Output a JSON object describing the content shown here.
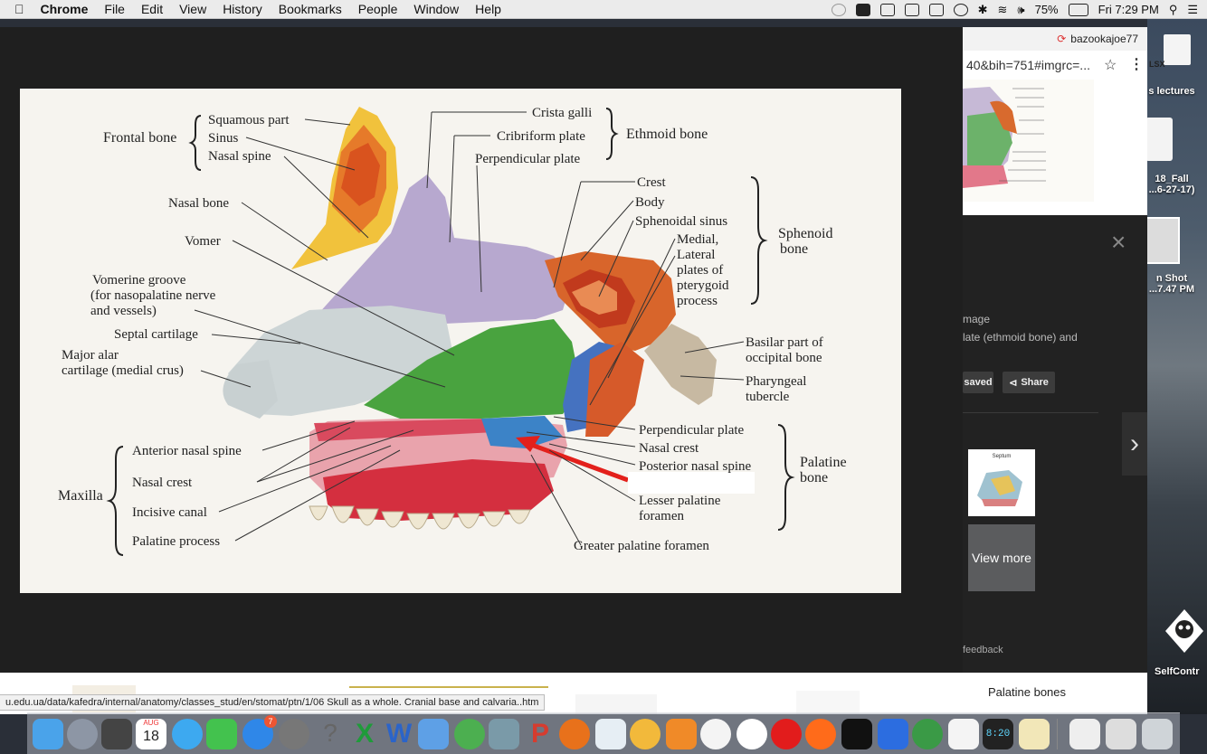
{
  "menubar": {
    "app": "Chrome",
    "menus": [
      "File",
      "Edit",
      "View",
      "History",
      "Bookmarks",
      "People",
      "Window",
      "Help"
    ],
    "battery": "75%",
    "clock": "Fri 7:29 PM"
  },
  "browser": {
    "user": "bazookajoe77",
    "address": "40&bih=751#imgrc=...",
    "status_url": "u.edu.ua/data/kafedra/internal/anatomy/classes_stud/en/stomat/ptn/1/06 Skull as a whole. Cranial base and calvaria..htm"
  },
  "image_panel": {
    "label_image": "mage",
    "caption": "late (ethmoid bone) and",
    "saved_label": "saved",
    "share_label": "Share",
    "feedback": "feedback",
    "related_title": "Septum",
    "view_more": "View more",
    "bottom_title": "Palatine bones"
  },
  "desktop": {
    "lectures": "s lectures",
    "file1_a": "18_Fall",
    "file1_b": "...6-27-17)",
    "shot_a": "n Shot",
    "shot_b": "...7.47 PM",
    "selfcontrol": "SelfContr",
    "xlsx": "LSX"
  },
  "figure": {
    "frontal_bone": "Frontal bone",
    "squamous": "Squamous part",
    "sinus": "Sinus",
    "nasal_spine": "Nasal spine",
    "nasal_bone": "Nasal bone",
    "vomer": "Vomer",
    "vomerine1": "Vomerine groove",
    "vomerine2": "(for nasopalatine nerve",
    "vomerine3": "and vessels)",
    "septal": "Septal cartilage",
    "major1": "Major alar",
    "major2": "cartilage (medial crus)",
    "crista": "Crista galli",
    "cribriform": "Cribriform plate",
    "perp_plate": "Perpendicular plate",
    "ethmoid": "Ethmoid bone",
    "crest": "Crest",
    "body": "Body",
    "sph_sinus": "Sphenoidal sinus",
    "medial": "Medial,",
    "lateral": "Lateral",
    "plates_of": "plates of",
    "pterygoid": "pterygoid",
    "process": "process",
    "sphenoid1": "Sphenoid",
    "sphenoid2": "bone",
    "basilar1": "Basilar part of",
    "basilar2": "occipital bone",
    "pharyngeal1": "Pharyngeal",
    "pharyngeal2": "tubercle",
    "pal_perp": "Perpendicular plate",
    "pal_crest": "Nasal crest",
    "post_spine": "Posterior nasal spine",
    "palatine1": "Palatine",
    "palatine2": "bone",
    "lesser1": "Lesser palatine",
    "lesser2": "foramen",
    "greater": "Greater palatine foramen",
    "ant_spine": "Anterior nasal spine",
    "max_crest": "Nasal crest",
    "incisive": "Incisive canal",
    "pal_process": "Palatine process",
    "maxilla": "Maxilla"
  },
  "dock": {
    "calendar_month": "AUG",
    "calendar_day": "18",
    "appstore_badge": "7",
    "clock_digits": "8:20"
  }
}
